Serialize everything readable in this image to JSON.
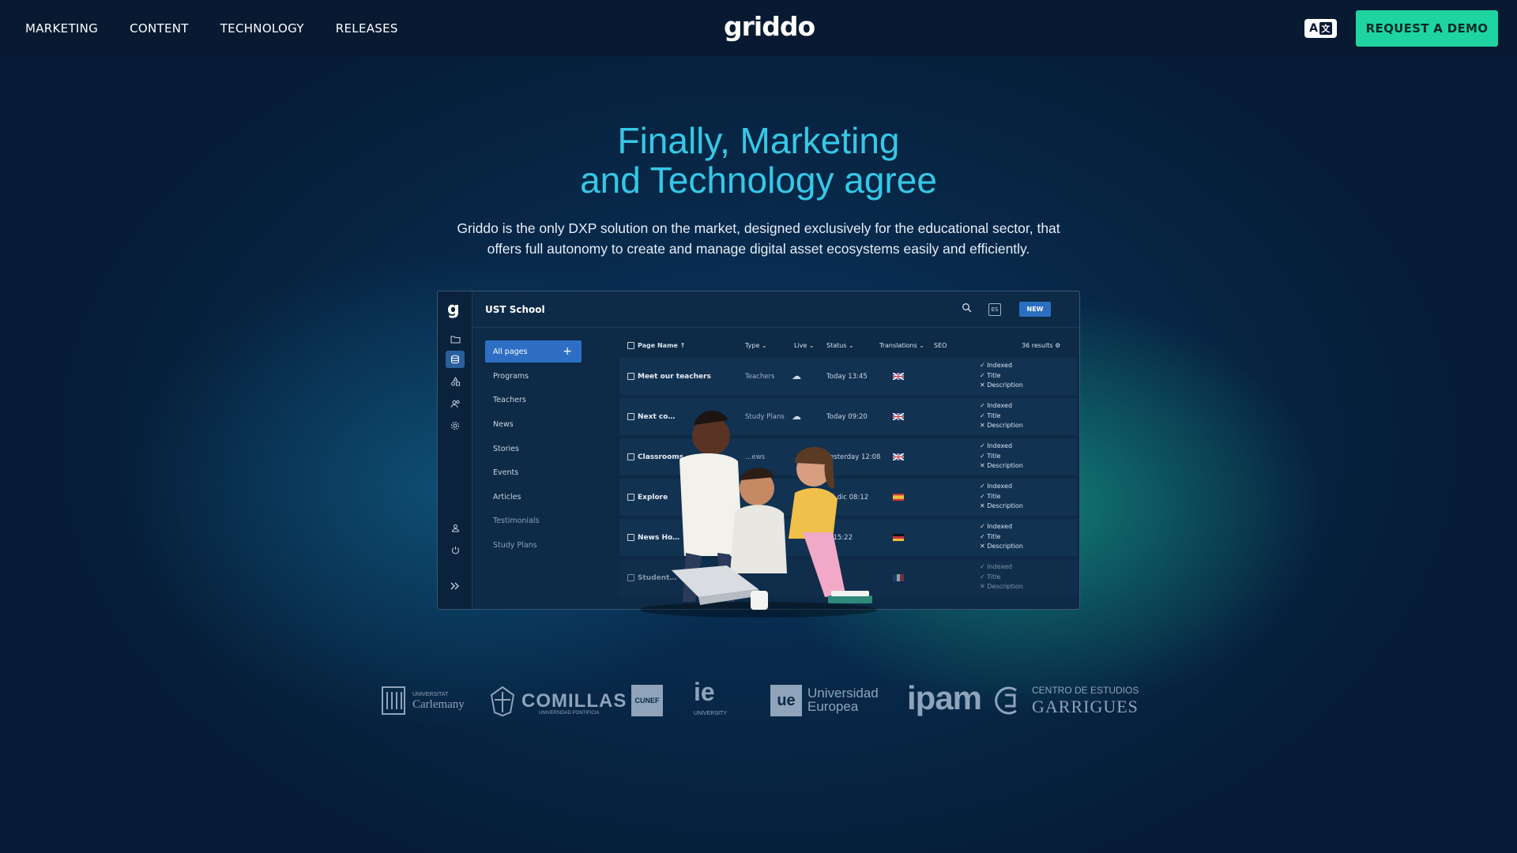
{
  "nav": {
    "links": [
      "MARKETING",
      "CONTENT",
      "TECHNOLOGY",
      "RELEASES"
    ],
    "logo": "griddo",
    "lang_label": "A",
    "lang_glyph": "文",
    "demo_label": "REQUEST A DEMO"
  },
  "hero": {
    "title_line1": "Finally, Marketing",
    "title_line2": "and Technology agree",
    "subtitle_line1": "Griddo is the only DXP solution on the market, designed exclusively for the educational sector, that",
    "subtitle_line2": "offers full autonomy to create and manage digital asset ecosystems easily and efficiently."
  },
  "app": {
    "rail_logo": "g",
    "title": "UST School",
    "es_label": "ES",
    "new_label": "NEW",
    "sidebar": {
      "active": "All pages",
      "items": [
        "Programs",
        "Teachers",
        "News",
        "Stories",
        "Events",
        "Articles",
        "Testimonials",
        "Study Plans"
      ]
    },
    "table": {
      "headers": {
        "name": "Page Name ↑",
        "type": "Type ⌄",
        "live": "Live ⌄",
        "status": "Status ⌄",
        "translations": "Translations ⌄",
        "seo": "SEO",
        "results": "36 results ⚙"
      },
      "rows": [
        {
          "name": "Meet our teachers",
          "type": "Teachers",
          "live": "☁",
          "status": "Today 13:45",
          "flag": "uk",
          "seo": [
            "✓ Indexed",
            "✓ Title",
            "✕ Description"
          ]
        },
        {
          "name": "Next co…",
          "type": "Study Plans",
          "live": "☁",
          "status": "Today 09:20",
          "flag": "uk",
          "seo": [
            "✓ Indexed",
            "✓ Title",
            "✕ Description"
          ]
        },
        {
          "name": "Classrooms",
          "type": "…ews",
          "live": "",
          "status": "Yesterday 12:08",
          "flag": "uk",
          "seo": [
            "✓ Indexed",
            "✓ Title",
            "✕ Description"
          ]
        },
        {
          "name": "Explore",
          "type": "",
          "live": "",
          "status": "15 dic 08:12",
          "flag": "es",
          "seo": [
            "✓ Indexed",
            "✓ Title",
            "✕ Description"
          ]
        },
        {
          "name": "News Ho…",
          "type": "",
          "live": "",
          "status": "…15:22",
          "flag": "de",
          "seo": [
            "✓ Indexed",
            "✓ Title",
            "✕ Description"
          ]
        },
        {
          "name": "Student…",
          "type": "",
          "live": "",
          "status": "",
          "flag": "fr",
          "seo": [
            "✓ Indexed",
            "✓ Title",
            "✕ Description"
          ]
        }
      ]
    }
  },
  "logos": {
    "carlemany_small": "UNIVERSITAT",
    "carlemany_big": "Carlemany",
    "comillas": "COMILLAS",
    "comillas_sub": "UNIVERSIDAD PONTIFICIA",
    "cunef": "CUNEF",
    "ie": "ie",
    "ie_sub": "UNIVERSITY",
    "ue_mark": "ue",
    "ue_line1": "Universidad",
    "ue_line2": "Europea",
    "ipam": "ipam",
    "garrigues_small": "CENTRO DE ESTUDIOS",
    "garrigues_big": "GARRIGUES"
  },
  "colors": {
    "nav_bg": "#071a31",
    "title_color": "#35c8e6",
    "demo_btn": "#1ed4a0",
    "active_blue": "#2f6fc3"
  }
}
